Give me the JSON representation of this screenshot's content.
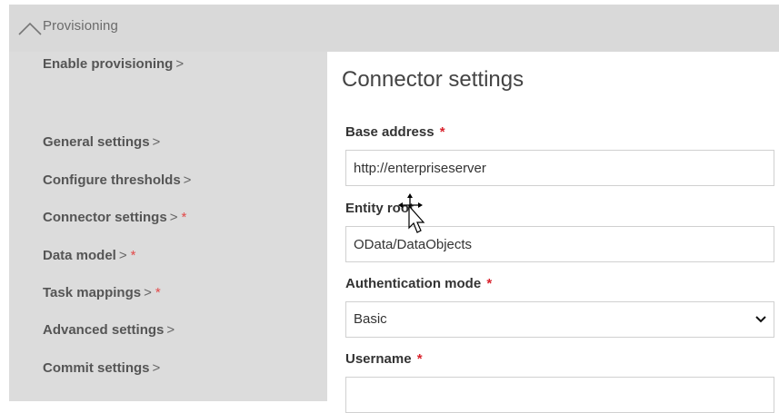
{
  "section": {
    "title": "Provisioning",
    "toggle_icon": "chevron-up-icon"
  },
  "nav": {
    "items": [
      {
        "label": "Enable provisioning",
        "chevron": ">",
        "required": ""
      },
      {
        "label": "General settings",
        "chevron": ">",
        "required": ""
      },
      {
        "label": "Configure thresholds",
        "chevron": ">",
        "required": ""
      },
      {
        "label": "Connector settings",
        "chevron": ">",
        "required": "*"
      },
      {
        "label": "Data model",
        "chevron": ">",
        "required": "*"
      },
      {
        "label": "Task mappings",
        "chevron": ">",
        "required": "*"
      },
      {
        "label": "Advanced settings",
        "chevron": ">",
        "required": ""
      },
      {
        "label": "Commit settings",
        "chevron": ">",
        "required": ""
      }
    ]
  },
  "form": {
    "title": "Connector settings",
    "base_address": {
      "label": "Base address",
      "required": "*",
      "value": "http://enterpriseserver"
    },
    "entity_root": {
      "label": "Entity root",
      "value": "OData/DataObjects"
    },
    "auth_mode": {
      "label": "Authentication mode",
      "required": "*",
      "selected": "Basic"
    },
    "username": {
      "label": "Username",
      "required": "*",
      "value": ""
    }
  },
  "colors": {
    "required": "#d9232d",
    "panel_bg": "#dcdcdc",
    "header_bg": "#d9d9d9"
  }
}
